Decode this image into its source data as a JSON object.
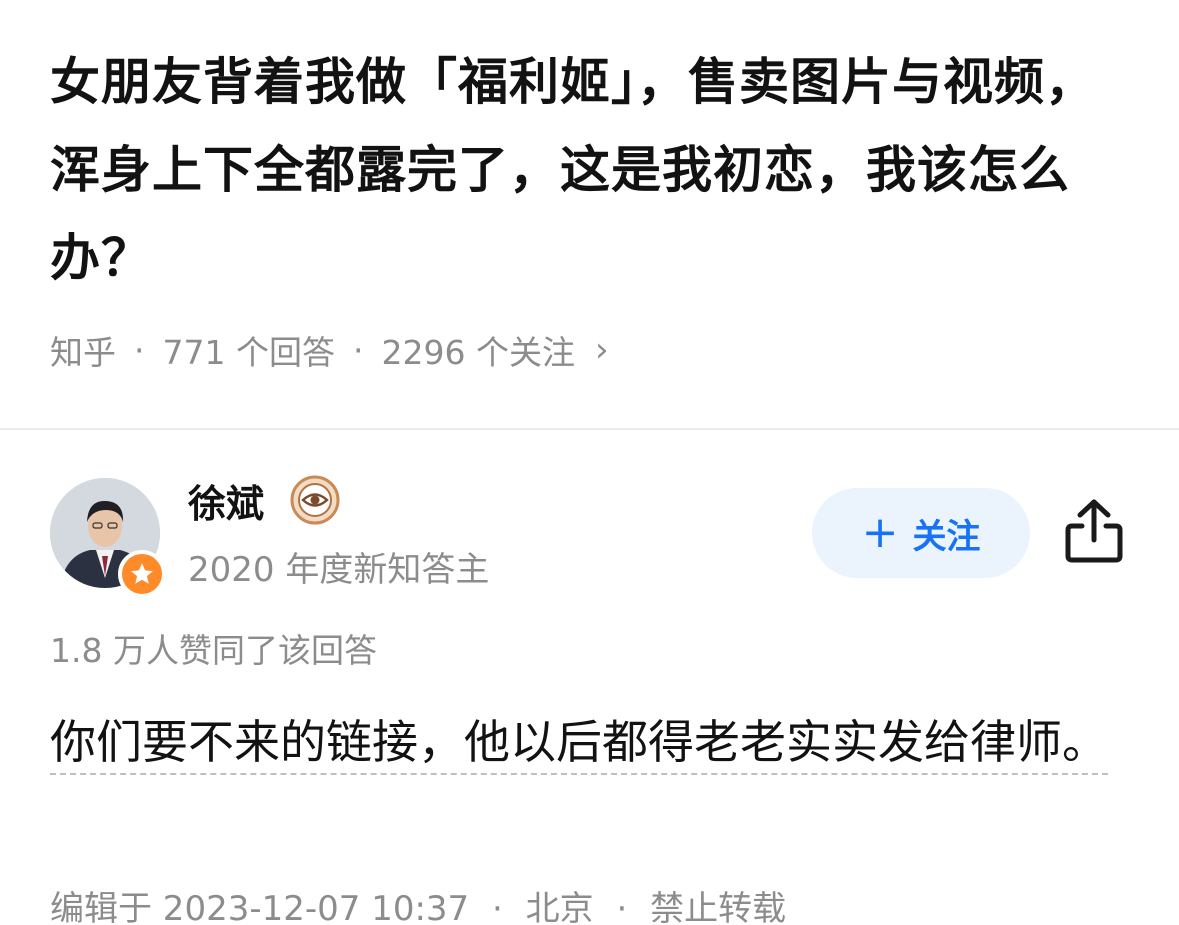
{
  "question": {
    "title": "女朋友背着我做「福利姬」，售卖图片与视频，浑身上下全都露完了，这是我初恋，我该怎么办？",
    "source": "知乎",
    "answers_count": "771 个回答",
    "followers_count": "2296 个关注",
    "chevron": "›"
  },
  "author": {
    "name": "徐斌",
    "subtitle": "2020 年度新知答主",
    "badge_icon": "eye-badge-icon",
    "avatar_badge_icon": "star-icon"
  },
  "actions": {
    "follow_plus": "+",
    "follow_label": "关注",
    "share_icon": "share-icon"
  },
  "answer": {
    "votes": "1.8 万人赞同了该回答",
    "body_linked": "你们要不来的链接，他以后都得老老实实发给律师。",
    "edit_info": "编辑于 2023-12-07 10:37",
    "location": "北京",
    "copyright": "禁止转载"
  },
  "colors": {
    "accent": "#1772f6",
    "follow_bg": "#ebf3fd",
    "secondary_text": "#8c8c8c",
    "badge_orange": "#ff8a2a"
  }
}
